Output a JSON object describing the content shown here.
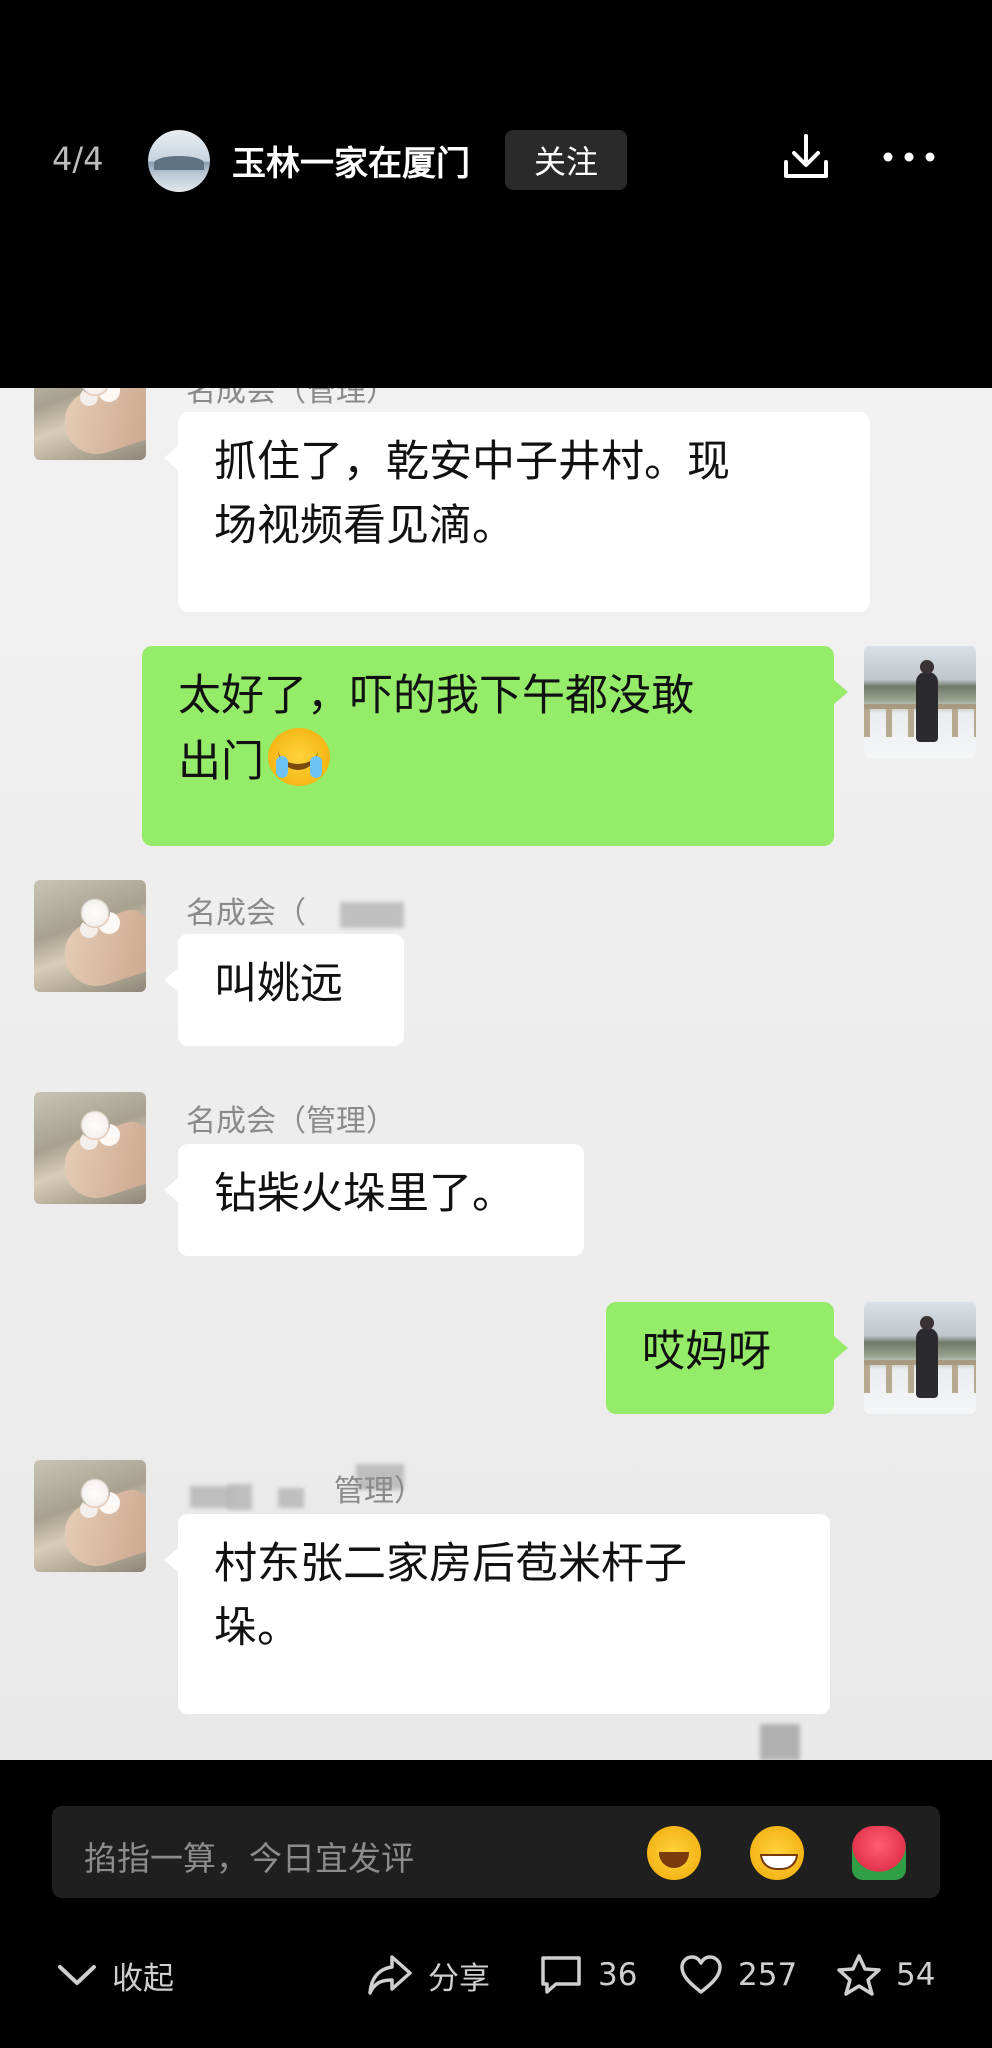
{
  "topbar": {
    "counter": "4/4",
    "author_name": "玉林一家在厦门",
    "follow_label": "关注",
    "icons": [
      "download-icon",
      "more-icon"
    ]
  },
  "chat": {
    "messages": [
      {
        "direction": "in",
        "sender": "名成会（管理）",
        "text_lines": [
          "抓住了，乾安中子井村。现",
          "场视频看见滴。"
        ]
      },
      {
        "direction": "out",
        "text_lines": [
          "太好了，吓的我下午都没敢",
          "出门"
        ],
        "emoji": "loudly-crying-face"
      },
      {
        "direction": "in",
        "sender": "名成会（",
        "text_lines": [
          "叫姚远"
        ]
      },
      {
        "direction": "in",
        "sender": "名成会（管理）",
        "text_lines": [
          "钻柴火垛里了。"
        ]
      },
      {
        "direction": "out",
        "text_lines": [
          "哎妈呀"
        ]
      },
      {
        "direction": "in",
        "sender": "管理）",
        "text_lines": [
          "村东张二家房后苞米杆子",
          "垛。"
        ]
      }
    ]
  },
  "comment_bar": {
    "placeholder": "掐指一算，今日宜发评",
    "emojis": [
      "laughing-crying-emoji",
      "grinning-emoji",
      "rose-emoji"
    ]
  },
  "actions": {
    "collapse_label": "收起",
    "share_label": "分享",
    "comment_count": "36",
    "like_count": "257",
    "star_count": "54"
  },
  "colors": {
    "outgoing_bubble": "#95ec69",
    "incoming_bubble": "#ffffff",
    "chat_background": "#ededed",
    "app_background": "#000000"
  }
}
